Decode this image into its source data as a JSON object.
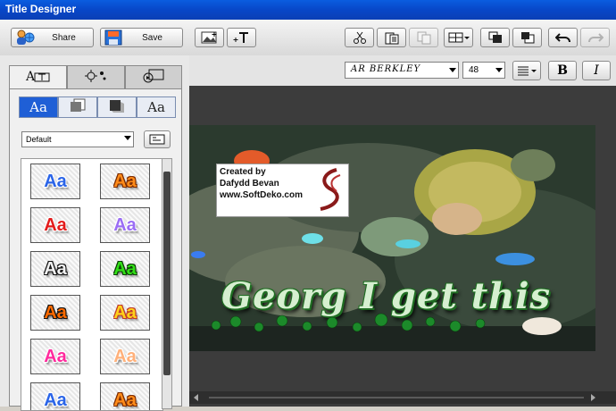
{
  "window": {
    "title": "Title Designer"
  },
  "toolbar": {
    "share_label": "Share",
    "save_label": "Save",
    "icons": [
      "insert-image-icon",
      "add-text-icon",
      "cut-icon",
      "paste-icon",
      "copy-icon",
      "align-icon",
      "bring-forward-icon",
      "send-backward-icon",
      "undo-icon",
      "redo-icon"
    ]
  },
  "left_panel": {
    "tabs": [
      "text-style-tab",
      "effects-tab",
      "motion-tab"
    ],
    "style_tabs": [
      "Aa",
      "",
      "",
      "Aa"
    ],
    "preset_select": {
      "value": "Default"
    },
    "swatch_text": "Aa",
    "swatches": [
      {
        "fill": "#2a64e8",
        "stroke": "#ffffff"
      },
      {
        "fill": "#ff8c1a",
        "stroke": "#7a2a00"
      },
      {
        "fill": "#e31b1b",
        "stroke": "#ffffff"
      },
      {
        "fill": "#9b6df5",
        "stroke": "#ffffff"
      },
      {
        "fill": "#f2f2f2",
        "stroke": "#111111"
      },
      {
        "fill": "#33e018",
        "stroke": "#0b3b05"
      },
      {
        "fill": "#ff6a00",
        "stroke": "#111111"
      },
      {
        "fill": "#ffd21a",
        "stroke": "#c0392b"
      },
      {
        "fill": "#ff2a9d",
        "stroke": "#ffffff"
      },
      {
        "fill": "#ffb07a",
        "stroke": "#ffffff"
      },
      {
        "fill": "#2a64e8",
        "stroke": "#ffffff"
      },
      {
        "fill": "#ff8c1a",
        "stroke": "#7a2a00"
      }
    ]
  },
  "font_toolbar": {
    "font_name": "AR BERKLEY",
    "font_size": "48",
    "bold_label": "B",
    "italic_label": "I"
  },
  "canvas": {
    "credit_lines": [
      "Created by",
      "Dafydd Bevan",
      "www.SoftDeko.com"
    ],
    "caption_text": "Georg I get this"
  },
  "colors": {
    "titlebar": "#0847c8",
    "accent_tab": "#1f5fd6",
    "caption_green": "#1f6d22"
  }
}
